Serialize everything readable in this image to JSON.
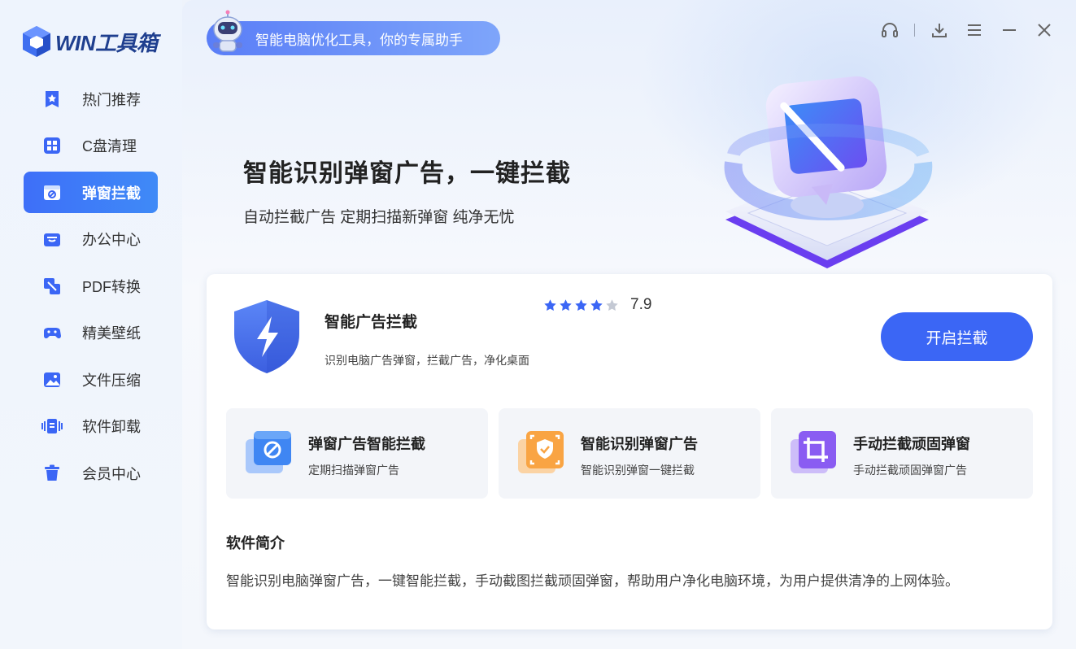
{
  "app": {
    "logo_text": "WIN工具箱"
  },
  "sidebar": {
    "items": [
      {
        "label": "热门推荐",
        "icon": "star-badge-icon"
      },
      {
        "label": "C盘清理",
        "icon": "grid-icon"
      },
      {
        "label": "弹窗拦截",
        "icon": "popup-block-icon",
        "active": true
      },
      {
        "label": "办公中心",
        "icon": "briefcase-icon"
      },
      {
        "label": "PDF转换",
        "icon": "convert-icon"
      },
      {
        "label": "精美壁纸",
        "icon": "gamepad-icon"
      },
      {
        "label": "文件压缩",
        "icon": "image-icon"
      },
      {
        "label": "软件卸载",
        "icon": "uninstall-icon"
      },
      {
        "label": "会员中心",
        "icon": "trash-icon"
      }
    ]
  },
  "header": {
    "banner_text": "智能电脑优化工具，你的专属助手",
    "controls": [
      "headset-icon",
      "download-icon",
      "menu-icon",
      "minimize-icon",
      "close-icon"
    ]
  },
  "hero": {
    "title": "智能识别弹窗广告，一键拦截",
    "subtitle": "自动拦截广告 定期扫描新弹窗 纯净无忧"
  },
  "tool": {
    "name": "智能广告拦截",
    "description": "识别电脑广告弹窗，拦截广告，净化桌面",
    "rating_stars": 4,
    "rating_max": 5,
    "rating_value": "7.9",
    "button_label": "开启拦截"
  },
  "features": [
    {
      "title": "弹窗广告智能拦截",
      "subtitle": "定期扫描弹窗广告",
      "icon": "block-window-icon"
    },
    {
      "title": "智能识别弹窗广告",
      "subtitle": "智能识别弹窗一键拦截",
      "icon": "shield-scan-icon"
    },
    {
      "title": "手动拦截顽固弹窗",
      "subtitle": "手动拦截顽固弹窗广告",
      "icon": "crop-icon"
    }
  ],
  "intro": {
    "title": "软件简介",
    "text": "智能识别电脑弹窗广告，一键智能拦截，手动截图拦截顽固弹窗，帮助用户净化电脑环境，为用户提供清净的上网体验。"
  },
  "colors": {
    "accent": "#3b66f5",
    "star": "#3b66f5",
    "star_empty": "#c4c9d4"
  }
}
